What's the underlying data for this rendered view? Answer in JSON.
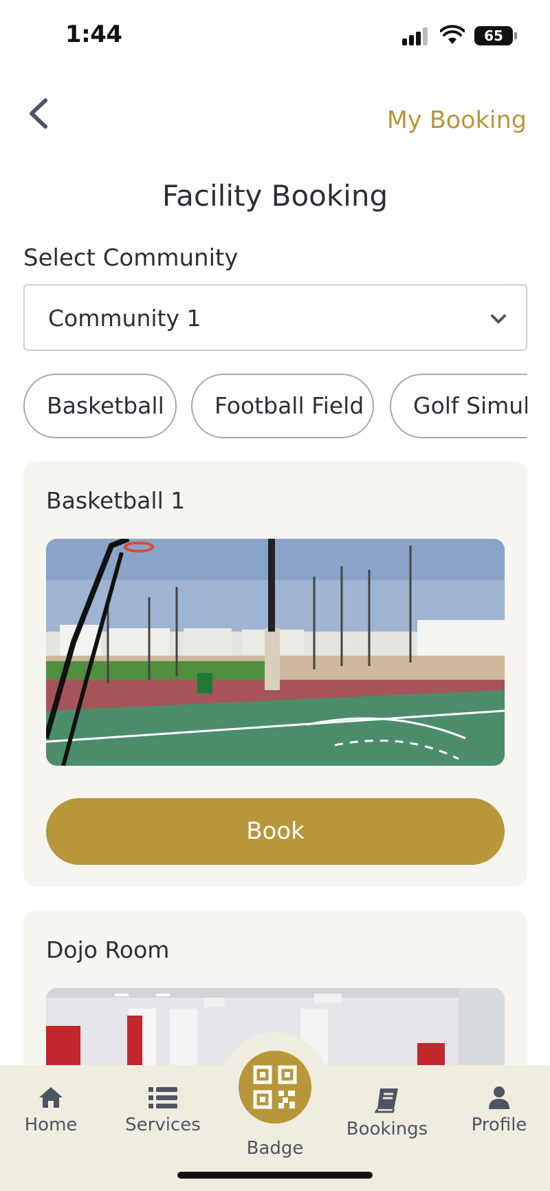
{
  "status_bar": {
    "time": "1:44",
    "battery": "65"
  },
  "header": {
    "my_booking_label": "My Booking"
  },
  "page": {
    "title": "Facility Booking"
  },
  "community": {
    "label": "Select Community",
    "selected": "Community 1"
  },
  "categories": [
    "Basketball",
    "Football Field",
    "Golf Simulator"
  ],
  "facilities": [
    {
      "name": "Basketball 1",
      "book_label": "Book"
    },
    {
      "name": "Dojo Room"
    }
  ],
  "nav": {
    "home": "Home",
    "services": "Services",
    "badge": "Badge",
    "bookings": "Bookings",
    "profile": "Profile"
  },
  "colors": {
    "accent": "#b8963a",
    "nav_bg": "#f0ece0",
    "card_bg": "#f6f5f0"
  }
}
